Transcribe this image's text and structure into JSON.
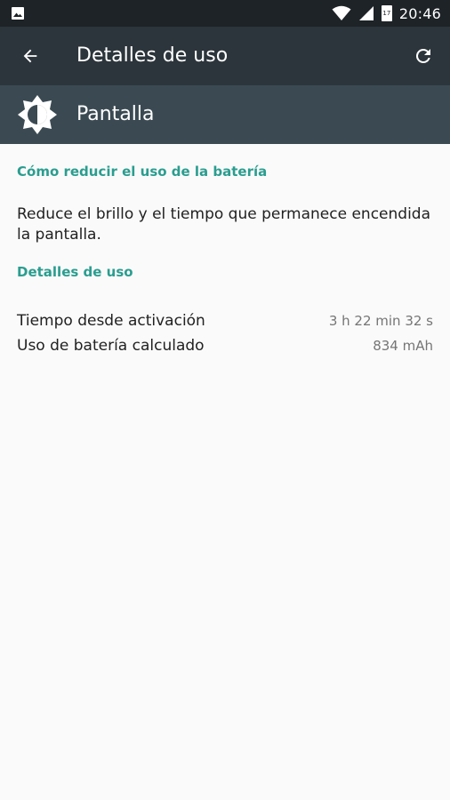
{
  "status_bar": {
    "time": "20:46",
    "calendar_day": "17",
    "left_icon": "image-icon",
    "wifi_icon": "wifi-icon",
    "signal_icon": "signal-icon",
    "battery_icon": "calendar-battery-icon"
  },
  "app_bar": {
    "title": "Detalles de uso",
    "back_icon": "back-arrow-icon",
    "refresh_icon": "refresh-icon"
  },
  "header": {
    "title": "Pantalla",
    "icon": "brightness-icon"
  },
  "sections": {
    "reduce": {
      "title": "Cómo reducir el uso de la batería",
      "text": "Reduce el brillo y el tiempo que permanece encendida la pantalla."
    },
    "usage": {
      "title": "Detalles de uso",
      "rows": [
        {
          "label": "Tiempo desde activación",
          "value": "3 h 22 min 32 s"
        },
        {
          "label": "Uso de batería calculado",
          "value": "834 mAh"
        }
      ]
    }
  },
  "colors": {
    "accent": "#2a9d8f",
    "status_bar": "#1d2327",
    "app_bar": "#2c353b",
    "header_band": "#3b4a52",
    "background": "#fafafa"
  }
}
